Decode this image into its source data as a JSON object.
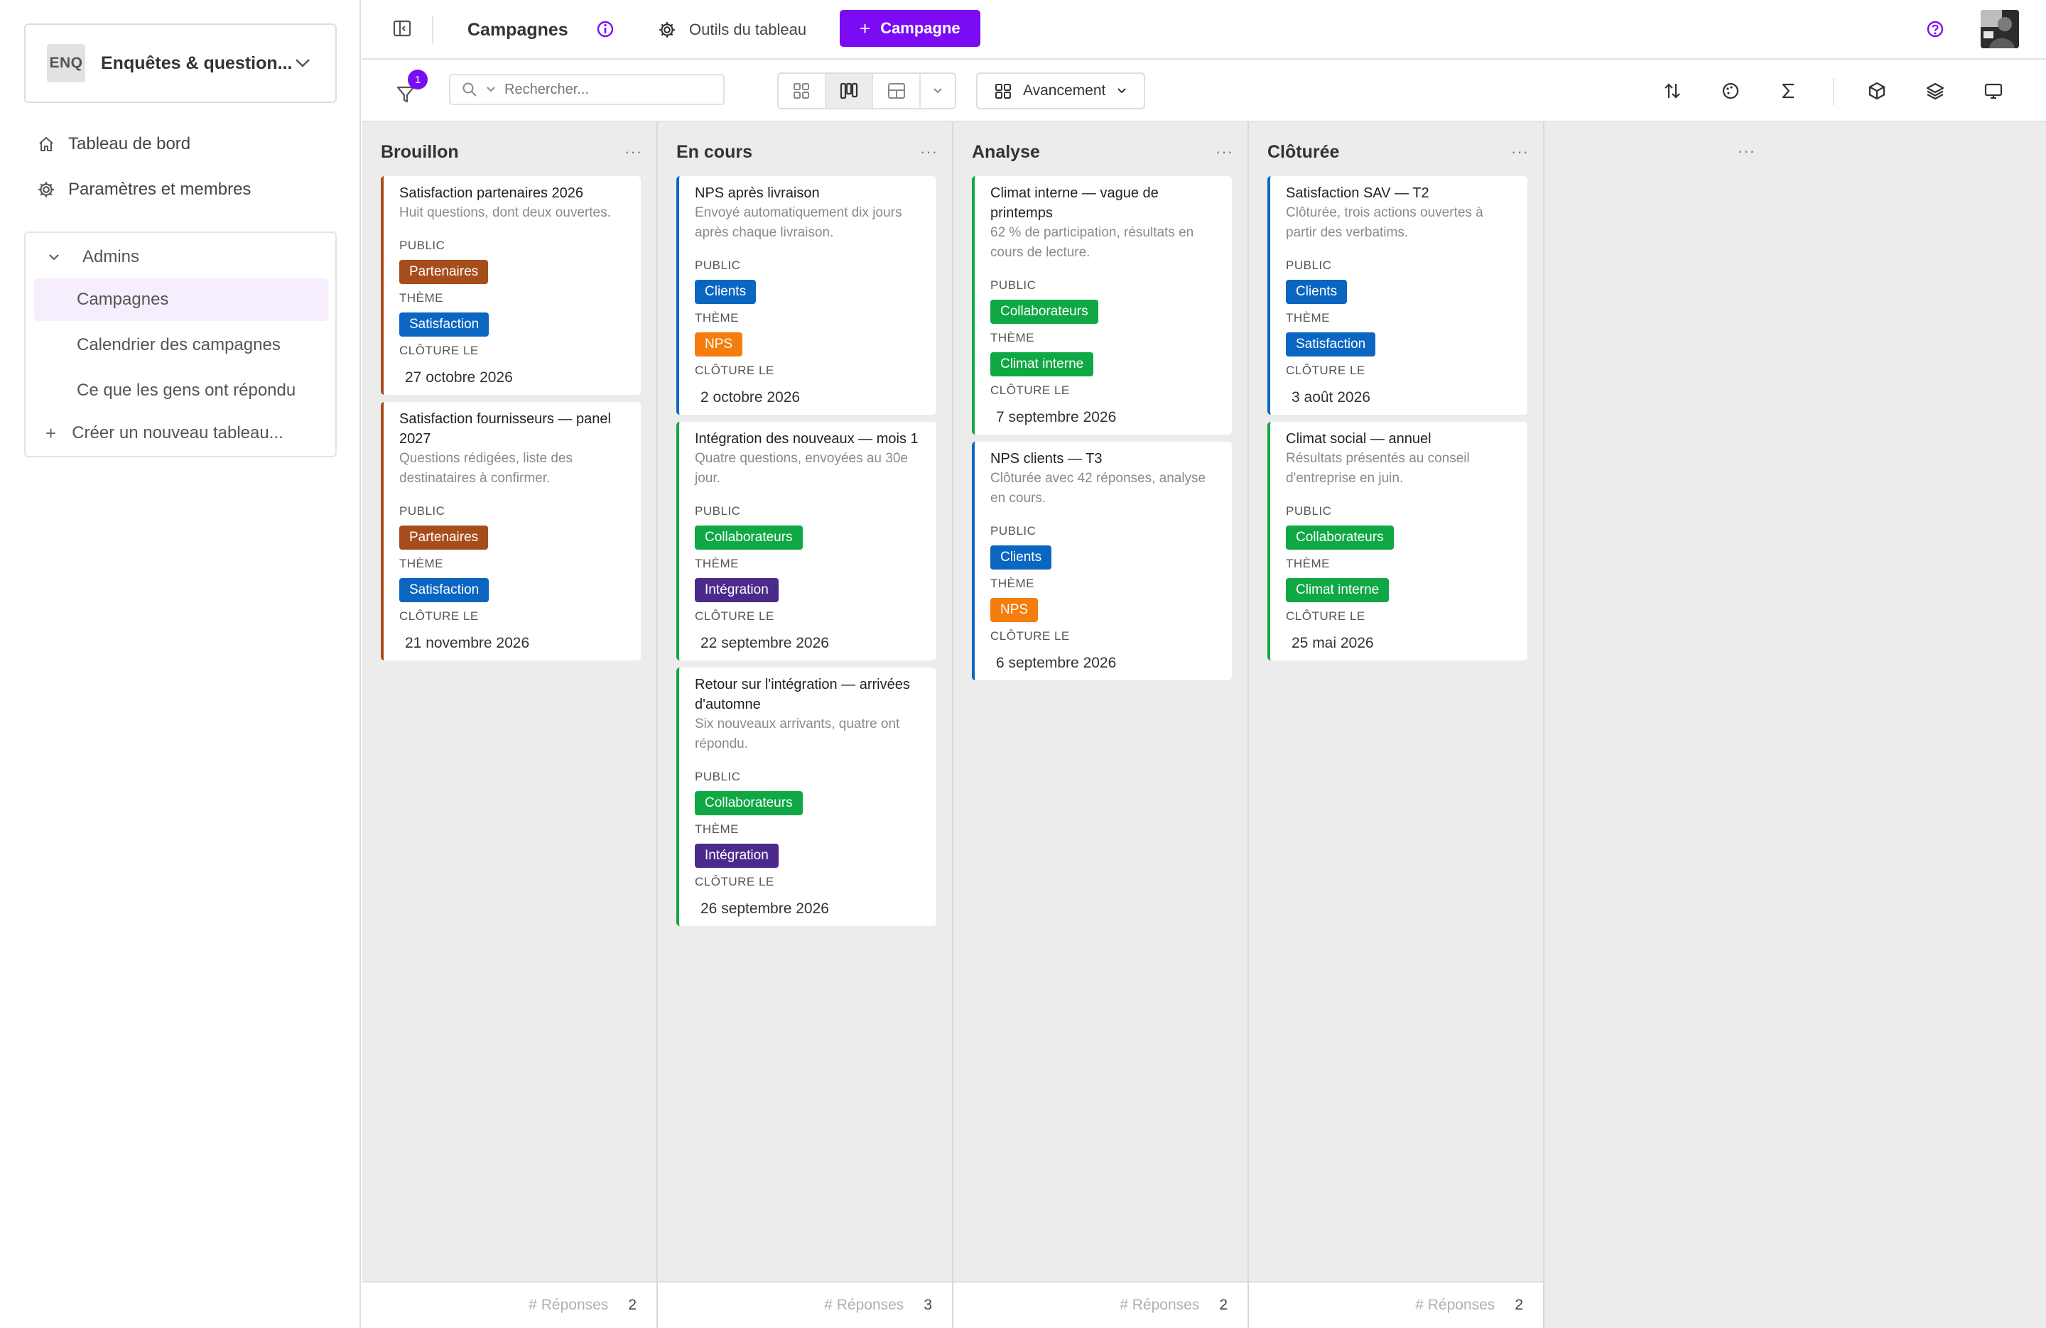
{
  "colors": {
    "accent": "#7a0bf2",
    "tag_partenaires": "#a64d1b",
    "tag_satisfaction": "#0b66c2",
    "tag_clients": "#0b66c2",
    "tag_nps": "#f57d0d",
    "tag_collaborateurs": "#0fa844",
    "tag_climat_interne": "#0fa844",
    "tag_integration": "#4c2a8c",
    "column_brouillon": "#a64d1b",
    "column_en_cours_blue": "#0b66c2",
    "column_en_cours_green": "#0fa844"
  },
  "sidebar": {
    "workspace_badge": "ENQ",
    "workspace_name": "Enquêtes & question...",
    "nav": [
      {
        "label": "Tableau de bord",
        "icon": "home-icon"
      },
      {
        "label": "Paramètres et membres",
        "icon": "gear-icon"
      }
    ],
    "group": {
      "label": "Admins",
      "items": [
        {
          "label": "Campagnes",
          "active": true
        },
        {
          "label": "Calendrier des campagnes",
          "active": false
        },
        {
          "label": "Ce que les gens ont répondu",
          "active": false
        }
      ],
      "new_label": "Créer un nouveau tableau..."
    }
  },
  "topbar": {
    "view_title": "Campagnes",
    "tools_label": "Outils du tableau",
    "add_label": "Campagne"
  },
  "toolbar": {
    "filter_count": "1",
    "search_placeholder": "Rechercher...",
    "group_by_label": "Avancement",
    "active_view": "kanban"
  },
  "field_labels": {
    "public": "PUBLIC",
    "theme": "THÈME",
    "closes": "CLÔTURE LE"
  },
  "footer_label": "# Réponses",
  "columns": [
    {
      "title": "Brouillon",
      "count": "2",
      "cards": [
        {
          "title": "Satisfaction partenaires 2026",
          "desc": "Huit questions, dont deux ouvertes.",
          "public": "Partenaires",
          "public_color": "#a64d1b",
          "theme": "Satisfaction",
          "theme_color": "#0b66c2",
          "date": "27 octobre 2026",
          "border": "#a64d1b"
        },
        {
          "title": "Satisfaction fournisseurs — panel 2027",
          "desc": "Questions rédigées, liste des destinataires à confirmer.",
          "public": "Partenaires",
          "public_color": "#a64d1b",
          "theme": "Satisfaction",
          "theme_color": "#0b66c2",
          "date": "21 novembre 2026",
          "border": "#a64d1b"
        }
      ]
    },
    {
      "title": "En cours",
      "count": "3",
      "cards": [
        {
          "title": "NPS après livraison",
          "desc": "Envoyé automatiquement dix jours après chaque livraison.",
          "public": "Clients",
          "public_color": "#0b66c2",
          "theme": "NPS",
          "theme_color": "#f57d0d",
          "date": "2 octobre 2026",
          "border": "#0b66c2"
        },
        {
          "title": "Intégration des nouveaux — mois 1",
          "desc": "Quatre questions, envoyées au 30e jour.",
          "public": "Collaborateurs",
          "public_color": "#0fa844",
          "theme": "Intégration",
          "theme_color": "#4c2a8c",
          "date": "22 septembre 2026",
          "border": "#0fa844"
        },
        {
          "title": "Retour sur l'intégration — arrivées d'automne",
          "desc": "Six nouveaux arrivants, quatre ont répondu.",
          "public": "Collaborateurs",
          "public_color": "#0fa844",
          "theme": "Intégration",
          "theme_color": "#4c2a8c",
          "date": "26 septembre 2026",
          "border": "#0fa844"
        }
      ]
    },
    {
      "title": "Analyse",
      "count": "2",
      "cards": [
        {
          "title": "Climat interne — vague de printemps",
          "desc": "62 % de participation, résultats en cours de lecture.",
          "public": "Collaborateurs",
          "public_color": "#0fa844",
          "theme": "Climat interne",
          "theme_color": "#0fa844",
          "date": "7 septembre 2026",
          "border": "#0fa844"
        },
        {
          "title": "NPS clients — T3",
          "desc": "Clôturée avec 42 réponses, analyse en cours.",
          "public": "Clients",
          "public_color": "#0b66c2",
          "theme": "NPS",
          "theme_color": "#f57d0d",
          "date": "6 septembre 2026",
          "border": "#0b66c2"
        }
      ]
    },
    {
      "title": "Clôturée",
      "count": "2",
      "cards": [
        {
          "title": "Satisfaction SAV — T2",
          "desc": "Clôturée, trois actions ouvertes à partir des verbatims.",
          "public": "Clients",
          "public_color": "#0b66c2",
          "theme": "Satisfaction",
          "theme_color": "#0b66c2",
          "date": "3 août 2026",
          "border": "#0b66c2"
        },
        {
          "title": "Climat social — annuel",
          "desc": "Résultats présentés au conseil d'entreprise en juin.",
          "public": "Collaborateurs",
          "public_color": "#0fa844",
          "theme": "Climat interne",
          "theme_color": "#0fa844",
          "date": "25 mai 2026",
          "border": "#0fa844"
        }
      ]
    }
  ]
}
